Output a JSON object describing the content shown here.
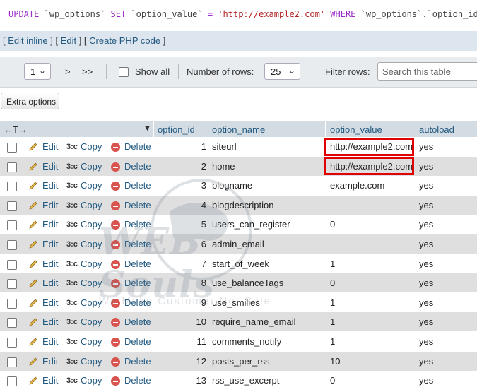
{
  "sql": {
    "k_update": "UPDATE",
    "t_table": "`wp_options`",
    "k_set": "SET",
    "c_col": "`option_value`",
    "op_eq": "=",
    "s_val": "'http://example2.com'",
    "k_where": "WHERE",
    "c_tail": "`wp_options`.`option_id"
  },
  "links": {
    "edit_inline": "Edit inline",
    "edit": "Edit",
    "create_php": "Create PHP code"
  },
  "nav": {
    "page_value": "1",
    "next": ">",
    "last": ">>",
    "show_all": "Show all",
    "rows_label": "Number of rows:",
    "rows_value": "25",
    "filter_label": "Filter rows:",
    "search_placeholder": "Search this table"
  },
  "extra_options": "Extra options",
  "table": {
    "arrows": "←T→",
    "columns": [
      "option_id",
      "option_name",
      "option_value",
      "autoload"
    ],
    "action_labels": {
      "edit": "Edit",
      "copy": "Copy",
      "delete": "Delete"
    },
    "rows": [
      {
        "id": "1",
        "name": "siteurl",
        "value": "http://example2.com",
        "autoload": "yes"
      },
      {
        "id": "2",
        "name": "home",
        "value": "http://example2.com",
        "autoload": "yes"
      },
      {
        "id": "3",
        "name": "blogname",
        "value": "example.com",
        "autoload": "yes"
      },
      {
        "id": "4",
        "name": "blogdescription",
        "value": "",
        "autoload": "yes"
      },
      {
        "id": "5",
        "name": "users_can_register",
        "value": "0",
        "autoload": "yes"
      },
      {
        "id": "6",
        "name": "admin_email",
        "value": "",
        "autoload": "yes"
      },
      {
        "id": "7",
        "name": "start_of_week",
        "value": "1",
        "autoload": "yes"
      },
      {
        "id": "8",
        "name": "use_balanceTags",
        "value": "0",
        "autoload": "yes"
      },
      {
        "id": "9",
        "name": "use_smilies",
        "value": "1",
        "autoload": "yes"
      },
      {
        "id": "10",
        "name": "require_name_email",
        "value": "1",
        "autoload": "yes"
      },
      {
        "id": "11",
        "name": "comments_notify",
        "value": "1",
        "autoload": "yes"
      },
      {
        "id": "12",
        "name": "posts_per_rss",
        "value": "10",
        "autoload": "yes"
      },
      {
        "id": "13",
        "name": "rss_use_excerpt",
        "value": "0",
        "autoload": "yes"
      }
    ]
  },
  "watermark": {
    "brand": "WEB Souls",
    "tagline": "We Make Customer Not Sale"
  },
  "colors": {
    "link": "#235a81",
    "highlight_box": "#e00000",
    "delete_icon": "#d9534f"
  }
}
